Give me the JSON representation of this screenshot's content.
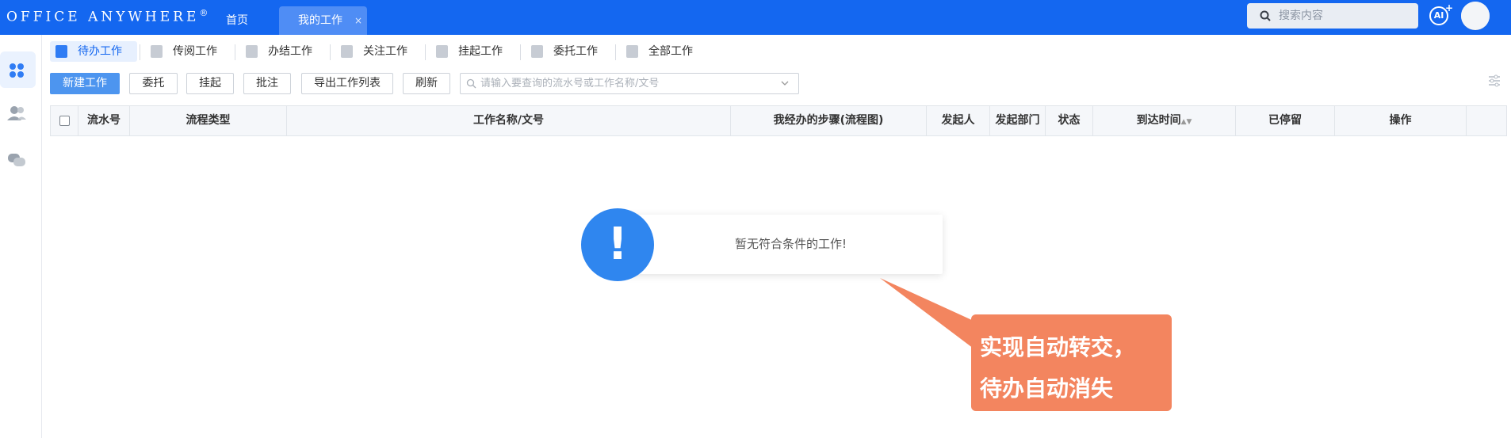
{
  "header": {
    "logo": "Office Anywhere",
    "logo_mark": "®",
    "nav": [
      {
        "label": "首页"
      },
      {
        "label": "我的工作",
        "active": true,
        "close": "×"
      }
    ],
    "search_placeholder": "搜索内容",
    "ai_label": "AI",
    "ai_plus": "+"
  },
  "tabs": [
    {
      "label": "待办工作",
      "icon": "todo-icon",
      "active": true
    },
    {
      "label": "传阅工作",
      "icon": "circulate-icon"
    },
    {
      "label": "办结工作",
      "icon": "done-icon"
    },
    {
      "label": "关注工作",
      "icon": "bookmark-icon"
    },
    {
      "label": "挂起工作",
      "icon": "suspend-icon"
    },
    {
      "label": "委托工作",
      "icon": "delegate-icon"
    },
    {
      "label": "全部工作",
      "icon": "all-icon"
    }
  ],
  "toolbar": {
    "new_work": "新建工作",
    "delegate": "委托",
    "suspend": "挂起",
    "annotate": "批注",
    "export": "导出工作列表",
    "refresh": "刷新",
    "query_placeholder": "请输入要查询的流水号或工作名称/文号"
  },
  "table": {
    "columns": [
      "流水号",
      "流程类型",
      "工作名称/文号",
      "我经办的步骤(流程图)",
      "发起人",
      "发起部门",
      "状态",
      "到达时间",
      "已停留",
      "操作"
    ]
  },
  "empty": {
    "message": "暂无符合条件的工作!",
    "icon_glyph": "!"
  },
  "callout": {
    "line1": "实现自动转交，",
    "line2": "待办自动消失"
  },
  "colors": {
    "brand": "#1467f0",
    "primary_button": "#4d95ef",
    "callout": "#f3855f",
    "online": "#29c45b"
  }
}
